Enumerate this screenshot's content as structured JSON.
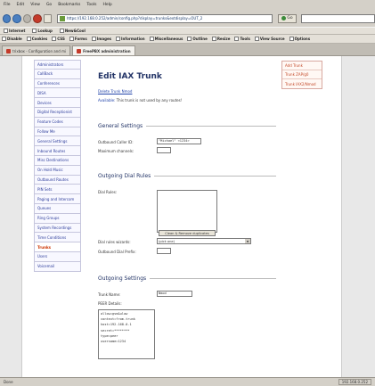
{
  "menu": [
    "File",
    "Edit",
    "View",
    "Go",
    "Bookmarks",
    "Tools",
    "Help"
  ],
  "nav": {
    "url": "https://192.168.0.252/admin/config.php?display=trunks&extdisplay=OUT_2",
    "go_label": "Go"
  },
  "bookmarks": [
    "Internet",
    "Lookup",
    "New&Cool"
  ],
  "toolbar": [
    "Disable",
    "Cookies",
    "CSS",
    "Forms",
    "Images",
    "Information",
    "Miscellaneous",
    "Outline",
    "Resize",
    "Tools",
    "View Source",
    "Options"
  ],
  "tabs": [
    {
      "label": "trixbox - Configuration and mi",
      "active": false
    },
    {
      "label": "FreePBX administration",
      "active": true
    }
  ],
  "sidebar": [
    {
      "label": "Administrators",
      "active": false
    },
    {
      "label": "CallBack",
      "active": false
    },
    {
      "label": "Conferences",
      "active": false
    },
    {
      "label": "DISA",
      "active": false
    },
    {
      "label": "Devices",
      "active": false
    },
    {
      "label": "Digital Receptionist",
      "active": false
    },
    {
      "label": "Feature Codes",
      "active": false
    },
    {
      "label": "Follow Me",
      "active": false
    },
    {
      "label": "General Settings",
      "active": false
    },
    {
      "label": "Inbound Routes",
      "active": false
    },
    {
      "label": "Misc Destinations",
      "active": false
    },
    {
      "label": "On Hold Music",
      "active": false
    },
    {
      "label": "Outbound Routes",
      "active": false
    },
    {
      "label": "PIN Sets",
      "active": false
    },
    {
      "label": "Paging and Intercom",
      "active": false
    },
    {
      "label": "Queues",
      "active": false
    },
    {
      "label": "Ring Groups",
      "active": false
    },
    {
      "label": "System Recordings",
      "active": false
    },
    {
      "label": "Time Conditions",
      "active": false
    },
    {
      "label": "Trunks",
      "active": true
    },
    {
      "label": "Users",
      "active": false
    },
    {
      "label": "Voicemail",
      "active": false
    }
  ],
  "right_menu": [
    "Add Trunk",
    "Trunk ZAP/g0",
    "Trunk IAX2/Nmod"
  ],
  "main": {
    "title": "Edit IAX Trunk",
    "delete_link": "Delete Trunk Nmod",
    "usage_label": "Available:",
    "usage_text": "This trunk is not used by any routes!",
    "general_heading": "General Settings",
    "callerid_label": "Outbound Caller ID:",
    "callerid_value": "\"Michael\" <1234>",
    "maxchans_label": "Maximum channels:",
    "maxchans_value": "",
    "dialrules_heading": "Outgoing Dial Rules",
    "dialrules_label": "Dial Rules:",
    "dialrules_value": "",
    "cleanup_button": "Clean & Remove duplicates",
    "wizards_label": "Dial rules wizards:",
    "wizards_value": "(pick one)",
    "prefix_label": "Outbound Dial Prefix:",
    "prefix_value": "",
    "outgoing_heading": "Outgoing Settings",
    "trunkname_label": "Trunk Name:",
    "trunkname_value": "Nmod",
    "peer_label": "PEER Details:",
    "peer_details": "allow=gsm&ulaw\ncontext=from-trunk\nhost=192.168.0.1\nsecret=********\ntype=peer\nusername=1234"
  },
  "status": {
    "left": "Done",
    "right": "192.168.0.252"
  }
}
